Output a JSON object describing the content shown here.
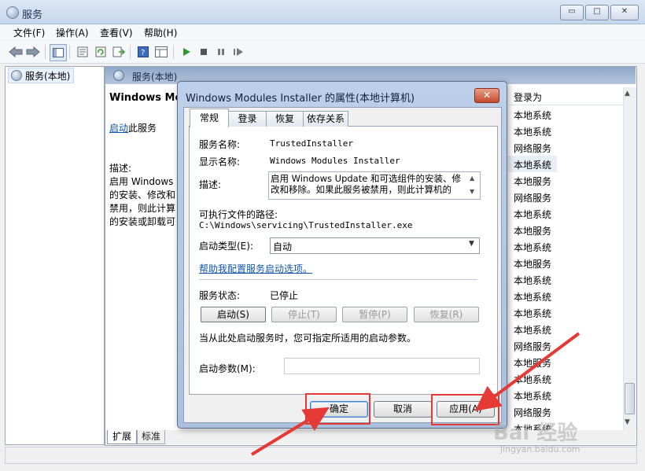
{
  "window": {
    "title": "服务",
    "caption_min": "▭",
    "caption_max": "□",
    "caption_close": "✕"
  },
  "menu": [
    "文件(F)",
    "操作(A)",
    "查看(V)",
    "帮助(H)"
  ],
  "toolbar_icons": [
    "back-arrow-icon",
    "forward-arrow-icon",
    "console-tree-icon",
    "properties-icon",
    "refresh-icon",
    "export-list-icon",
    "help-icon",
    "details-icon",
    "play-icon",
    "stop-icon",
    "pause-icon",
    "restart-icon"
  ],
  "tree": {
    "root_label": "服务(本地)"
  },
  "right_panel": {
    "header": "服务(本地)",
    "service_name_trunc": "Windows Mod",
    "start_link": "启动",
    "start_rest": "此服务",
    "desc_label": "描述:",
    "desc_lines": [
      "启用 Windows",
      "的安装、修改和",
      "禁用，则此计算",
      "的安装或卸载可"
    ],
    "logon_header": "登录为",
    "logon_values": [
      "本地系统",
      "本地系统",
      "网络服务",
      "本地系统",
      "本地服务",
      "网络服务",
      "本地系统",
      "本地服务",
      "本地系统",
      "本地服务",
      "本地系统",
      "本地系统",
      "本地系统",
      "本地系统",
      "网络服务",
      "本地服务",
      "本地系统",
      "本地系统",
      "网络服务",
      "本地系统"
    ],
    "tabs": [
      "扩展",
      "标准"
    ]
  },
  "dialog": {
    "title": "Windows Modules Installer 的属性(本地计算机)",
    "close": "✕",
    "tabs": [
      "常规",
      "登录",
      "恢复",
      "依存关系"
    ],
    "service_name_label": "服务名称:",
    "service_name_value": "TrustedInstaller",
    "display_name_label": "显示名称:",
    "display_name_value": "Windows Modules Installer",
    "description_label": "描述:",
    "description_value": "启用 Windows Update 和可选组件的安装、修改和移除。如果此服务被禁用，则此计算机的",
    "path_label": "可执行文件的路径:",
    "path_value": "C:\\Windows\\servicing\\TrustedInstaller.exe",
    "startup_type_label": "启动类型(E):",
    "startup_type_value": "自动",
    "help_link": "帮助我配置服务启动选项。",
    "status_label": "服务状态:",
    "status_value": "已停止",
    "buttons": {
      "start": "启动(S)",
      "stop": "停止(T)",
      "pause": "暂停(P)",
      "resume": "恢复(R)"
    },
    "hint": "当从此处启动服务时，您可指定所适用的启动参数。",
    "param_label": "启动参数(M):",
    "param_value": "",
    "ok": "确定",
    "cancel": "取消",
    "apply": "应用(A)"
  },
  "watermark": {
    "logo": "Bai 经验",
    "url": "jingyan.baidu.com"
  },
  "colors": {
    "highlight": "#e53935",
    "link": "#1155aa",
    "title_gradient_top": "#dce7f5"
  }
}
